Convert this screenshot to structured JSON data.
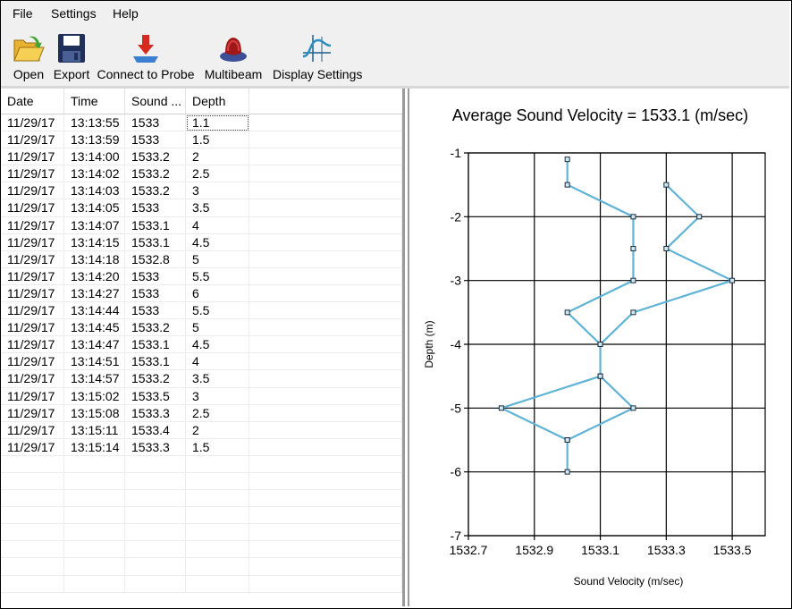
{
  "menu": {
    "file": "File",
    "settings": "Settings",
    "help": "Help"
  },
  "toolbar": {
    "open": "Open",
    "export": "Export",
    "connect": "Connect to Probe",
    "multibeam": "Multibeam",
    "display": "Display Settings"
  },
  "grid": {
    "columns": [
      "Date",
      "Time",
      "Sound ...",
      "Depth"
    ],
    "rows": [
      [
        "11/29/17",
        "13:13:55",
        "1533",
        "1.1"
      ],
      [
        "11/29/17",
        "13:13:59",
        "1533",
        "1.5"
      ],
      [
        "11/29/17",
        "13:14:00",
        "1533.2",
        "2"
      ],
      [
        "11/29/17",
        "13:14:02",
        "1533.2",
        "2.5"
      ],
      [
        "11/29/17",
        "13:14:03",
        "1533.2",
        "3"
      ],
      [
        "11/29/17",
        "13:14:05",
        "1533",
        "3.5"
      ],
      [
        "11/29/17",
        "13:14:07",
        "1533.1",
        "4"
      ],
      [
        "11/29/17",
        "13:14:15",
        "1533.1",
        "4.5"
      ],
      [
        "11/29/17",
        "13:14:18",
        "1532.8",
        "5"
      ],
      [
        "11/29/17",
        "13:14:20",
        "1533",
        "5.5"
      ],
      [
        "11/29/17",
        "13:14:27",
        "1533",
        "6"
      ],
      [
        "11/29/17",
        "13:14:44",
        "1533",
        "5.5"
      ],
      [
        "11/29/17",
        "13:14:45",
        "1533.2",
        "5"
      ],
      [
        "11/29/17",
        "13:14:47",
        "1533.1",
        "4.5"
      ],
      [
        "11/29/17",
        "13:14:51",
        "1533.1",
        "4"
      ],
      [
        "11/29/17",
        "13:14:57",
        "1533.2",
        "3.5"
      ],
      [
        "11/29/17",
        "13:15:02",
        "1533.5",
        "3"
      ],
      [
        "11/29/17",
        "13:15:08",
        "1533.3",
        "2.5"
      ],
      [
        "11/29/17",
        "13:15:11",
        "1533.4",
        "2"
      ],
      [
        "11/29/17",
        "13:15:14",
        "1533.3",
        "1.5"
      ]
    ],
    "empty_rows": 8
  },
  "chart_data": {
    "type": "line",
    "title": "Average Sound Velocity = 1533.1 (m/sec)",
    "xlabel": "Sound Velocity (m/sec)",
    "ylabel": "Depth (m)",
    "xlim": [
      1532.7,
      1533.6
    ],
    "ylim": [
      -7,
      -1
    ],
    "xticks": [
      1532.7,
      1532.9,
      1533.1,
      1533.3,
      1533.5
    ],
    "xtick_labels": [
      "1532.7",
      "1532.9",
      "1533.1",
      "1533.3",
      "1533.5"
    ],
    "yticks": [
      -1,
      -2,
      -3,
      -4,
      -5,
      -6,
      -7
    ],
    "ytick_labels": [
      "-1",
      "-2",
      "-3",
      "-4",
      "-5",
      "-6",
      "-7"
    ],
    "grid": true,
    "series": [
      {
        "x": [
          1533,
          1533,
          1533.2,
          1533.2,
          1533.2,
          1533,
          1533.1,
          1533.1,
          1532.8,
          1533,
          1533,
          1533,
          1533.2,
          1533.1,
          1533.1,
          1533.2,
          1533.5,
          1533.3,
          1533.4,
          1533.3
        ],
        "y": [
          -1.1,
          -1.5,
          -2,
          -2.5,
          -3,
          -3.5,
          -4,
          -4.5,
          -5,
          -5.5,
          -6,
          -5.5,
          -5,
          -4.5,
          -4,
          -3.5,
          -3,
          -2.5,
          -2,
          -1.5
        ],
        "color": "#5fb4d6"
      }
    ]
  }
}
